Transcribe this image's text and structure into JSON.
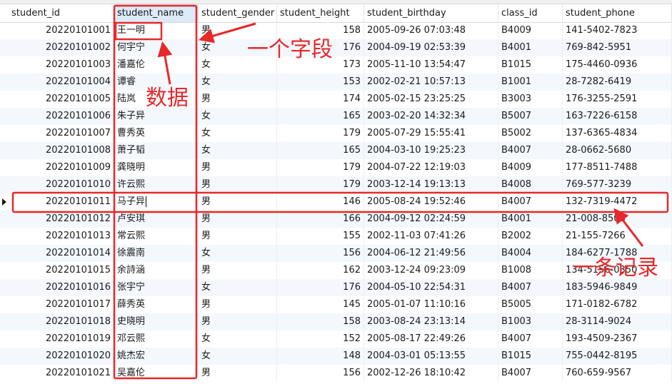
{
  "columns": [
    "student_id",
    "student_name",
    "student_gender",
    "student_height",
    "student_birthday",
    "class_id",
    "student_phone"
  ],
  "rows": [
    [
      "20220101001",
      "王一明",
      "男",
      "158",
      "2005-09-26 07:03:48",
      "B4009",
      "141-5402-7823"
    ],
    [
      "20220101002",
      "何宇宁",
      "女",
      "176",
      "2004-09-19 02:53:39",
      "B4001",
      "769-842-5951"
    ],
    [
      "20220101003",
      "潘嘉伦",
      "女",
      "173",
      "2005-11-10 13:54:47",
      "B1015",
      "175-4460-0936"
    ],
    [
      "20220101004",
      "谭睿",
      "女",
      "153",
      "2002-02-21 10:57:13",
      "B1001",
      "28-7282-6419"
    ],
    [
      "20220101005",
      "陆岚",
      "男",
      "174",
      "2005-02-15 23:25:25",
      "B3003",
      "176-3255-2591"
    ],
    [
      "20220101006",
      "朱子异",
      "女",
      "165",
      "2003-02-20 14:32:34",
      "B5007",
      "163-7226-6158"
    ],
    [
      "20220101007",
      "曹秀英",
      "女",
      "179",
      "2005-07-29 15:55:41",
      "B5002",
      "137-6365-4834"
    ],
    [
      "20220101008",
      "萧子韬",
      "女",
      "165",
      "2004-03-10 19:25:23",
      "B4007",
      "28-0662-5680"
    ],
    [
      "20220101009",
      "龚晓明",
      "男",
      "179",
      "2004-07-22 12:19:03",
      "B4009",
      "177-8511-7488"
    ],
    [
      "20220101010",
      "许云熙",
      "男",
      "179",
      "2003-12-14 19:13:13",
      "B4008",
      "769-577-3239"
    ],
    [
      "20220101011",
      "马子异",
      "男",
      "146",
      "2005-08-24 19:52:46",
      "B4007",
      "132-7319-4472"
    ],
    [
      "20220101012",
      "卢安琪",
      "男",
      "166",
      "2004-09-12 02:24:59",
      "B4001",
      "21-008-8508"
    ],
    [
      "20220101013",
      "常云熙",
      "男",
      "155",
      "2002-11-03 07:41:26",
      "B2002",
      "21-155-7266"
    ],
    [
      "20220101014",
      "徐震南",
      "女",
      "156",
      "2004-06-12 21:49:56",
      "B4004",
      "184-6277-1788"
    ],
    [
      "20220101015",
      "余詩涵",
      "男",
      "162",
      "2003-12-24 09:23:09",
      "B1008",
      "134-5156-0350"
    ],
    [
      "20220101016",
      "张宇宁",
      "女",
      "176",
      "2004-05-10 22:54:31",
      "B4007",
      "183-5946-9849"
    ],
    [
      "20220101017",
      "薛秀英",
      "男",
      "145",
      "2005-01-07 11:10:16",
      "B5005",
      "171-0182-6782"
    ],
    [
      "20220101018",
      "史晓明",
      "男",
      "158",
      "2003-08-24 23:13:14",
      "B1003",
      "28-3114-9024"
    ],
    [
      "20220101019",
      "邓云熙",
      "女",
      "152",
      "2005-08-17 22:49:26",
      "B4007",
      "193-4509-2367"
    ],
    [
      "20220101020",
      "姚杰宏",
      "女",
      "148",
      "2004-03-01 05:13:55",
      "B1015",
      "755-0442-8195"
    ],
    [
      "20220101021",
      "吴嘉伦",
      "男",
      "156",
      "2002-12-26 18:10:42",
      "B4007",
      "760-659-9567"
    ]
  ],
  "selected_row_index": 10,
  "annotations": {
    "field": "一个字段",
    "data": "数据",
    "record": "一条记录",
    "color": "#e8282a"
  },
  "colors": {
    "sorted_header": "#dbe9f8",
    "alt_row": "#f3f8fd"
  }
}
